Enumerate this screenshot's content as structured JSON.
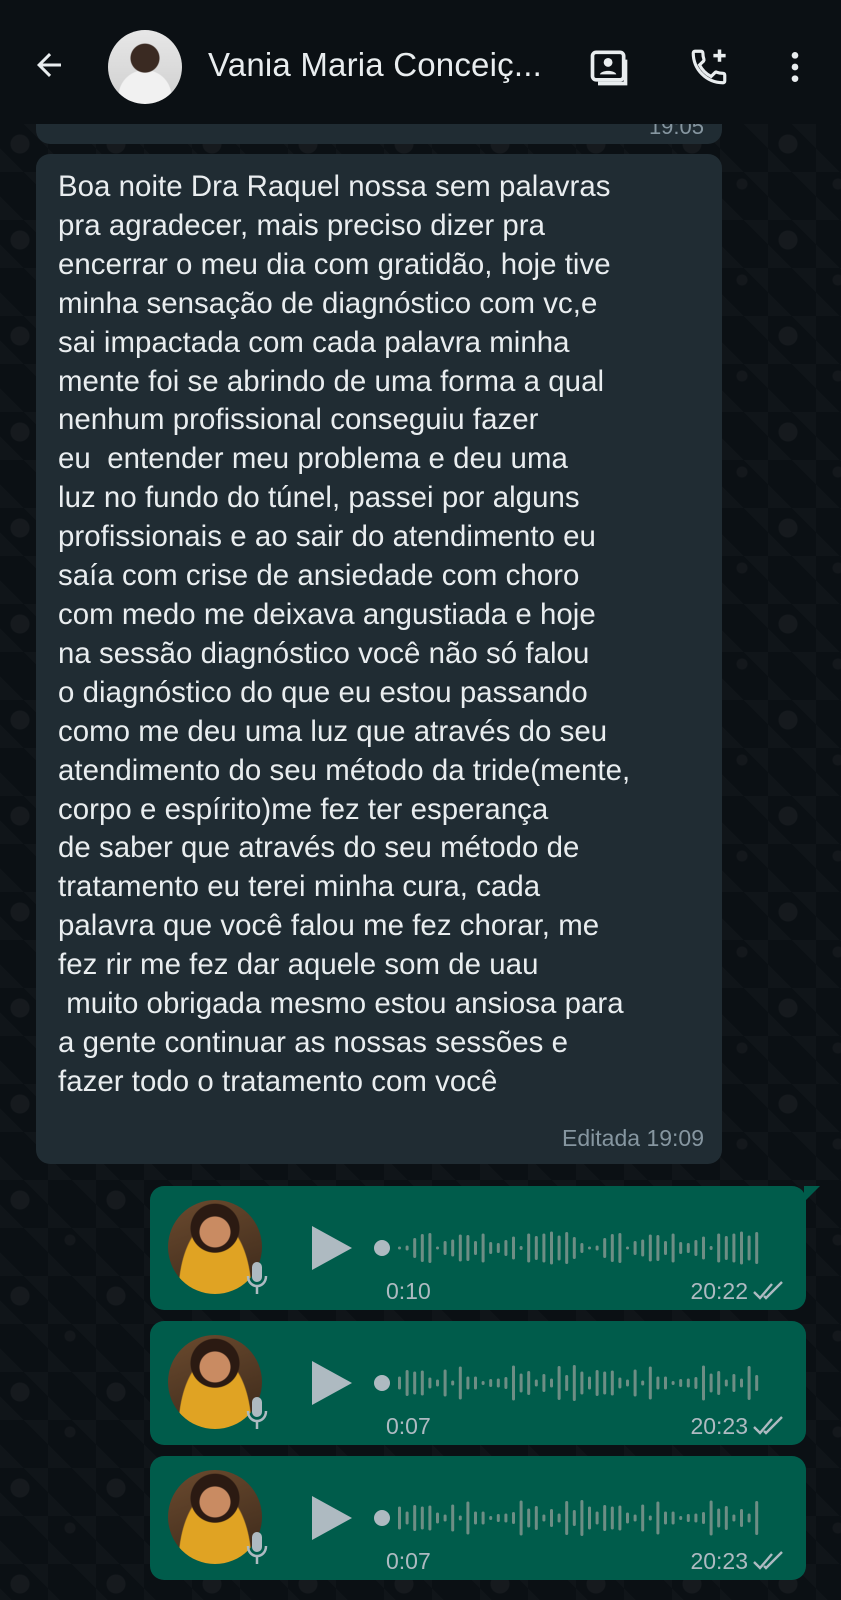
{
  "header": {
    "contact_name": "Vania Maria Conceiç...",
    "icons": [
      "back-arrow-icon",
      "contact-card-icon",
      "add-call-icon",
      "more-vert-icon"
    ]
  },
  "previous_message": {
    "time": "19:05"
  },
  "message": {
    "text": "Boa noite Dra Raquel nossa sem palavras\npra agradecer, mais preciso dizer pra\nencerrar o meu dia com gratidão, hoje tive\nminha sensação de diagnóstico com vc,e\nsai impactada com cada palavra minha\nmente foi se abrindo de uma forma a qual\nnenhum profissional conseguiu fazer\neu  entender meu problema e deu uma\nluz no fundo do túnel, passei por alguns\nprofissionais e ao sair do atendimento eu\nsaía com crise de ansiedade com choro\ncom medo me deixava angustiada e hoje\nna sessão diagnóstico você não só falou\no diagnóstico do que eu estou passando\ncomo me deu uma luz que através do seu\natendimento do seu método da tride(mente,\ncorpo e espírito)me fez ter esperança\nde saber que através do seu método de\ntratamento eu terei minha cura, cada\npalavra que você falou me fez chorar, me\nfez rir me fez dar aquele som de uau\n muito obrigada mesmo estou ansiosa para\na gente continuar as nossas sessões e\nfazer todo o tratamento com você",
    "meta": "Editada 19:09"
  },
  "voice_messages": [
    {
      "duration": "0:10",
      "time": "20:22",
      "status": "read"
    },
    {
      "duration": "0:07",
      "time": "20:23",
      "status": "read"
    },
    {
      "duration": "0:07",
      "time": "20:23",
      "status": "read"
    }
  ],
  "colors": {
    "background": "#0b1014",
    "incoming_bubble": "#202c33",
    "outgoing_bubble": "#005c4b",
    "read_ticks": "#aebac1"
  }
}
